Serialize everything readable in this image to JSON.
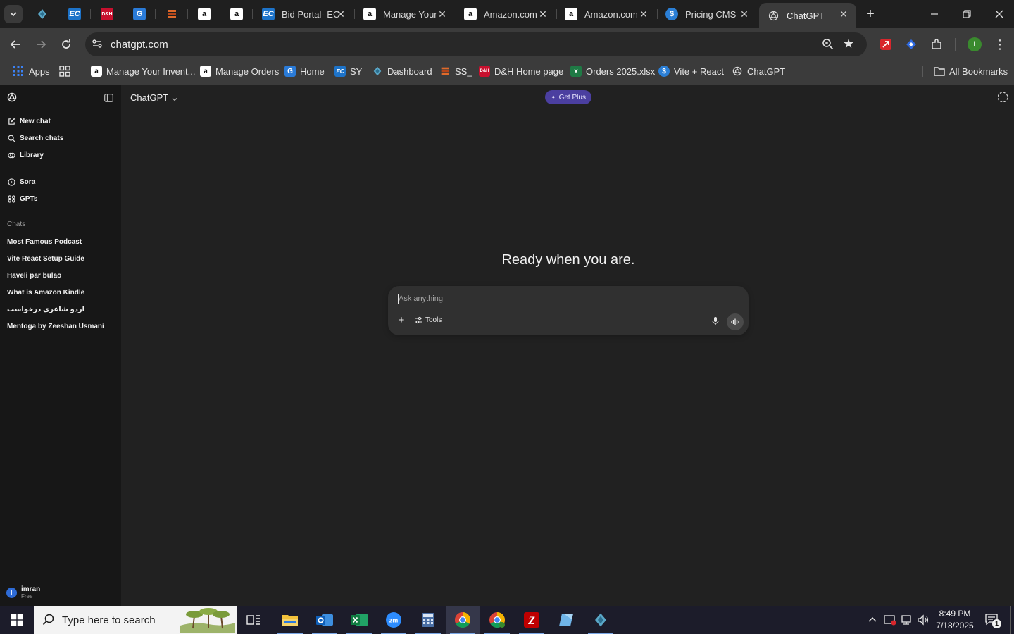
{
  "browser": {
    "tabs": [
      {
        "title": "Bid Portal- EC",
        "favicon": "ec-icon"
      },
      {
        "title": "Manage Your",
        "favicon": "amazon-icon"
      },
      {
        "title": "Amazon.com",
        "favicon": "amazon-icon"
      },
      {
        "title": "Amazon.com",
        "favicon": "amazon-icon"
      },
      {
        "title": "Pricing CMS",
        "favicon": "dollar-icon"
      },
      {
        "title": "ChatGPT",
        "favicon": "openai-icon",
        "active": true
      }
    ],
    "url": "chatgpt.com",
    "bookmarks": {
      "apps": "Apps",
      "items": [
        {
          "label": "Manage Your Invent...",
          "icon": "amazon-icon"
        },
        {
          "label": "Manage Orders",
          "icon": "amazon-icon"
        },
        {
          "label": "Home",
          "icon": "g-icon"
        },
        {
          "label": "SY",
          "icon": "ec-icon"
        },
        {
          "label": "Dashboard",
          "icon": "diamond-icon"
        },
        {
          "label": "SS_",
          "icon": "stack-icon"
        },
        {
          "label": "D&H Home page",
          "icon": "dh-icon"
        },
        {
          "label": "Orders 2025.xlsx",
          "icon": "excel-icon"
        },
        {
          "label": "Vite + React",
          "icon": "dollar-icon"
        },
        {
          "label": "ChatGPT",
          "icon": "openai-icon"
        }
      ],
      "all": "All Bookmarks"
    },
    "profile_initial": "I"
  },
  "sidebar": {
    "nav": [
      {
        "label": "New chat",
        "icon": "new-chat-icon"
      },
      {
        "label": "Search chats",
        "icon": "search-icon"
      },
      {
        "label": "Library",
        "icon": "library-icon"
      },
      {
        "label": "Sora",
        "icon": "sora-icon"
      },
      {
        "label": "GPTs",
        "icon": "gpts-icon"
      }
    ],
    "chats_heading": "Chats",
    "chats": [
      "Most Famous Podcast",
      "Vite React Setup Guide",
      "Haveli par bulao",
      "What is Amazon Kindle",
      "اردو شاعری درخواست",
      "Mentoga by Zeeshan Usmani"
    ],
    "user": {
      "initial": "I",
      "name": "imran",
      "plan": "Free"
    }
  },
  "main": {
    "model": "ChatGPT",
    "get_plus": "Get Plus",
    "headline": "Ready when you are.",
    "composer": {
      "placeholder": "Ask anything",
      "tools": "Tools"
    }
  },
  "taskbar": {
    "search_placeholder": "Type here to search",
    "time": "8:49 PM",
    "date": "7/18/2025",
    "notifications": "1"
  },
  "colors": {
    "accent_purple": "#4b3fa0",
    "background": "#212121",
    "sidebar": "#171717",
    "composer": "#303030"
  }
}
